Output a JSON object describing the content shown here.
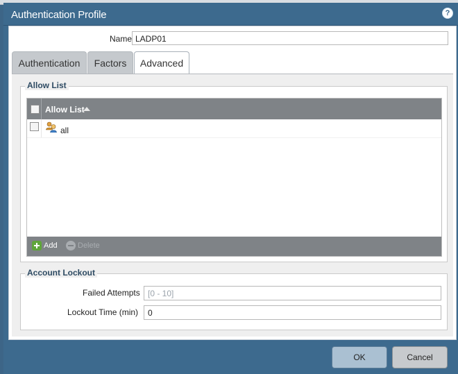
{
  "dialog": {
    "title": "Authentication Profile",
    "help_icon": "question-mark-icon",
    "help_glyph": "?"
  },
  "name": {
    "label": "Name",
    "value": "LADP01"
  },
  "tabs": [
    {
      "label": "Authentication",
      "active": false
    },
    {
      "label": "Factors",
      "active": false
    },
    {
      "label": "Advanced",
      "active": true
    }
  ],
  "allow_list": {
    "legend": "Allow List",
    "column_header": "Allow List",
    "sort": "ascending",
    "rows": [
      {
        "label": "all",
        "icon": "user-group-icon",
        "checked": false
      }
    ],
    "add_label": "Add",
    "delete_label": "Delete",
    "delete_enabled": false
  },
  "account_lockout": {
    "legend": "Account Lockout",
    "failed_attempts": {
      "label": "Failed Attempts",
      "placeholder": "[0 - 10]",
      "value": ""
    },
    "lockout_time": {
      "label": "Lockout Time (min)",
      "value": "0"
    }
  },
  "buttons": {
    "ok": "OK",
    "cancel": "Cancel"
  },
  "colors": {
    "title_bar": "#3d6a8e",
    "grid_header": "#7f8387",
    "ok_button": "#aac0d2",
    "cancel_button": "#c7cacd",
    "add_icon": "#5fa53a"
  }
}
